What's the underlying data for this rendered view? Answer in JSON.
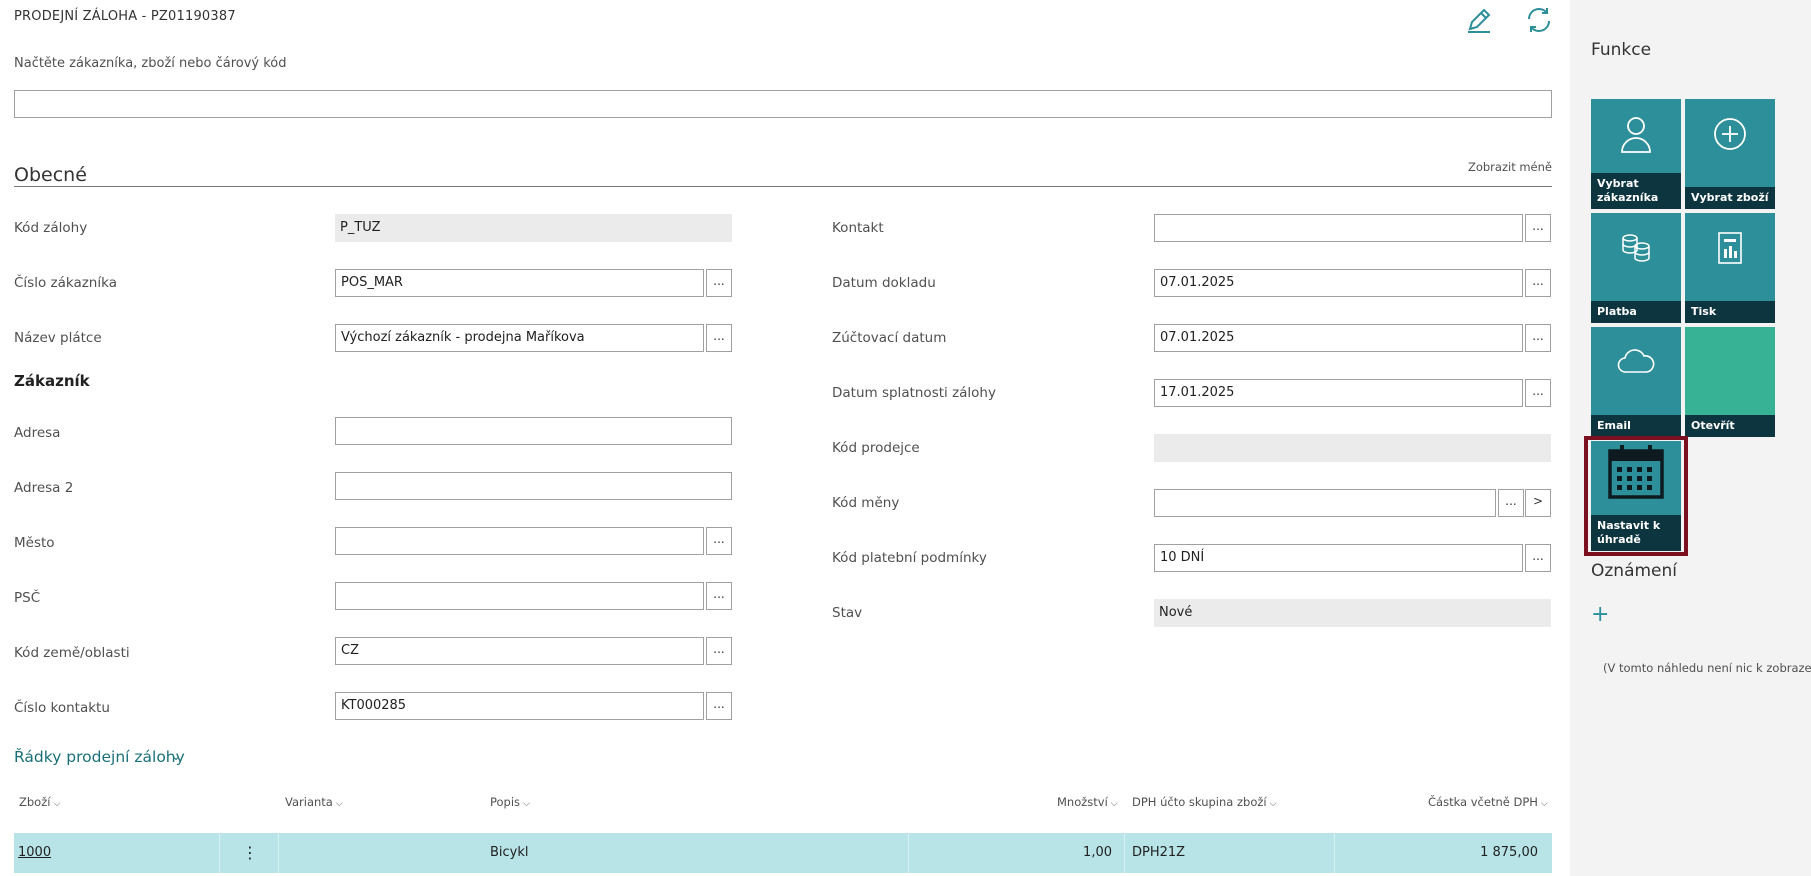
{
  "page": {
    "title": "PRODEJNÍ ZÁLOHA - PZ01190387",
    "scan_label": "Načtěte zákazníka, zboží nebo čárový kód",
    "scan_value": ""
  },
  "general": {
    "section_title": "Obecné",
    "show_less": "Zobrazit méně",
    "left_fields": {
      "deposit_code": {
        "label": "Kód zálohy",
        "value": "P_TUZ"
      },
      "customer_no": {
        "label": "Číslo zákazníka",
        "value": "POS_MAR"
      },
      "payer_name": {
        "label": "Název plátce",
        "value": "Výchozí zákazník - prodejna Maříkova"
      },
      "customer_heading": "Zákazník",
      "address": {
        "label": "Adresa",
        "value": ""
      },
      "address2": {
        "label": "Adresa 2",
        "value": ""
      },
      "city": {
        "label": "Město",
        "value": ""
      },
      "zip": {
        "label": "PSČ",
        "value": ""
      },
      "country": {
        "label": "Kód země/oblasti",
        "value": "CZ"
      },
      "contact_no": {
        "label": "Číslo kontaktu",
        "value": "KT000285"
      }
    },
    "right_fields": {
      "contact": {
        "label": "Kontakt",
        "value": ""
      },
      "document_date": {
        "label": "Datum dokladu",
        "value": "07.01.2025"
      },
      "posting_date": {
        "label": "Zúčtovací datum",
        "value": "07.01.2025"
      },
      "due_date": {
        "label": "Datum splatnosti zálohy",
        "value": "17.01.2025"
      },
      "salesperson": {
        "label": "Kód prodejce",
        "value": ""
      },
      "currency": {
        "label": "Kód měny",
        "value": ""
      },
      "payment_terms": {
        "label": "Kód platební podmínky",
        "value": "10 DNÍ"
      },
      "status": {
        "label": "Stav",
        "value": "Nové"
      }
    },
    "dots": "...",
    "arrow": ">"
  },
  "lines": {
    "title": "Řádky prodejní zálohy",
    "columns": {
      "item": "Zboží",
      "variant": "Varianta",
      "description": "Popis",
      "quantity": "Množství",
      "vat_group": "DPH účto skupina zboží",
      "amount": "Částka včetně DPH"
    },
    "row": {
      "item": "1000",
      "variant": "",
      "description": "Bicykl",
      "quantity": "1,00",
      "vat_group": "DPH21Z",
      "amount": "1 875,00",
      "menu": "⋮"
    }
  },
  "sidebar": {
    "functions_title": "Funkce",
    "tiles": {
      "select_customer": "Vybrat zákazníka",
      "select_item": "Vybrat zboží",
      "payment": "Platba",
      "print": "Tisk",
      "email": "Email",
      "open": "Otevřít",
      "set_payment": "Nastavit k úhradě"
    },
    "notifications_title": "Oznámení",
    "add": "+",
    "empty_note": "(V tomto náhledu není nic k zobrazení)"
  },
  "colors": {
    "accent": "#2d8f99",
    "tile_label_bg": "#0d3540",
    "tile_green": "#37b294",
    "selection_frame": "#7b1020",
    "row_highlight": "#b8e4e8",
    "link": "#1a7079"
  },
  "icons": {
    "edit": "pencil-icon",
    "refresh": "refresh-icon",
    "customer": "person-icon",
    "item": "plus-circle-icon",
    "payment": "coins-icon",
    "print": "report-icon",
    "email": "cloud-icon",
    "calendar": "calendar-icon"
  }
}
